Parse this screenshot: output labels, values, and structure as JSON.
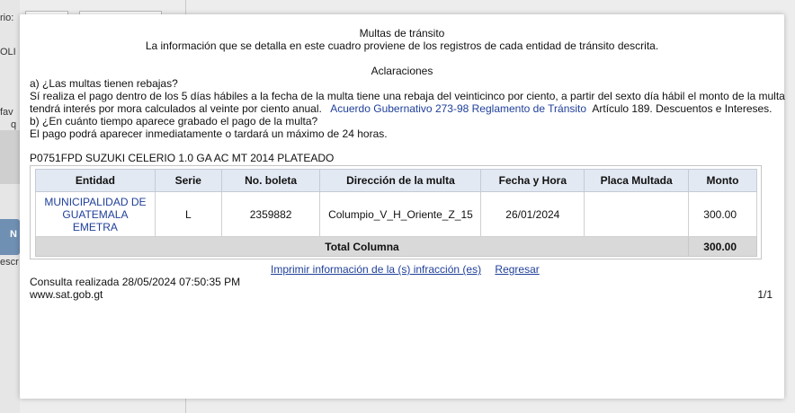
{
  "background": {
    "frag_1": "rio:",
    "frag_2": "OLI",
    "frag_3": "fav",
    "frag_4": "q",
    "frag_5": "N",
    "frag_6": "escr"
  },
  "dialog": {
    "title": "Multas de tránsito",
    "subtitle": "La información que se detalla en este cuadro proviene de los registros de cada entidad de tránsito descrita.",
    "section_heading": "Aclaraciones",
    "q_a": "a) ¿Las multas tienen rebajas?",
    "answer_a_line1": "Sí realiza el pago dentro de los 5 días hábiles a la fecha de la multa tiene una rebaja del veinticinco por ciento, a partir del sexto día hábil el monto de la multa",
    "answer_a_line2_pre": "tendrá interés por mora calculados al veinte por ciento anual.",
    "answer_a_link": "Acuerdo Gubernativo 273-98 Reglamento de Tránsito",
    "answer_a_line2_post": "Artículo 189. Descuentos e Intereses.",
    "q_b": "b) ¿En cuánto tiempo aparece grabado el pago de la multa?",
    "answer_b": "El pago podrá aparecer inmediatamente o tardará un máximo de 24 horas.",
    "vehicle": "P0751FPD SUZUKI CELERIO 1.0 GA AC MT 2014 PLATEADO",
    "table": {
      "headers": [
        "Entidad",
        "Serie",
        "No. boleta",
        "Dirección de la multa",
        "Fecha y Hora",
        "Placa Multada",
        "Monto"
      ],
      "rows": [
        {
          "entidad_line1": "MUNICIPALIDAD DE",
          "entidad_line2": "GUATEMALA",
          "entidad_line3": "EMETRA",
          "serie": "L",
          "boleta": "2359882",
          "direccion": "Columpio_V_H_Oriente_Z_15",
          "fecha": "26/01/2024",
          "placa": "",
          "monto": "300.00"
        }
      ],
      "total_label": "Total Columna",
      "total_value": "300.00"
    },
    "print_link": "Imprimir información de la (s) infracción (es)",
    "back_link": "Regresar",
    "consulta": "Consulta realizada 28/05/2024 07:50:35 PM",
    "website": "www.sat.gob.gt",
    "page_indicator": "1/1"
  }
}
